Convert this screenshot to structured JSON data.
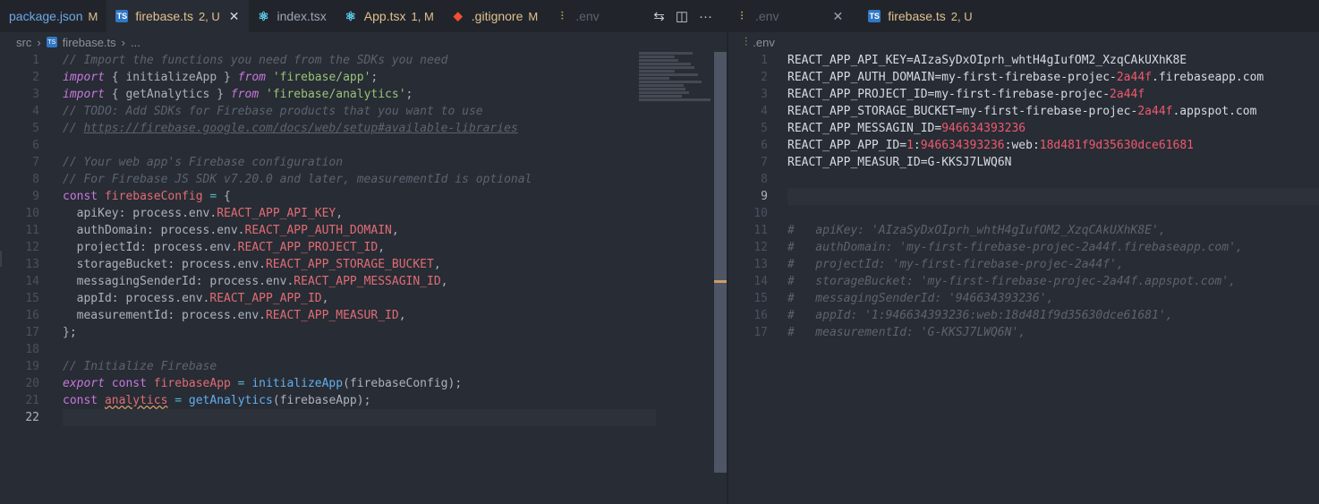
{
  "left_tabs": [
    {
      "name": "package.json",
      "status": "M",
      "icon": "npm-icon"
    },
    {
      "name": "firebase.ts",
      "status": "2, U",
      "icon": "ts-icon",
      "active": true
    },
    {
      "name": "index.tsx",
      "status": "",
      "icon": "react-icon"
    },
    {
      "name": "App.tsx",
      "status": "1, M",
      "icon": "react-icon"
    },
    {
      "name": ".gitignore",
      "status": "M",
      "icon": "git-icon"
    },
    {
      "name": ".env",
      "status": "",
      "icon": "env-icon"
    }
  ],
  "right_tabs": [
    {
      "name": ".env",
      "status": "",
      "icon": "env-icon",
      "active": true
    },
    {
      "name": "firebase.ts",
      "status": "2, U",
      "icon": "ts-icon"
    }
  ],
  "left_breadcrumb": {
    "folder": "src",
    "file": "firebase.ts",
    "more": "..."
  },
  "right_breadcrumb": {
    "file": ".env"
  },
  "icons": {
    "ts": "TS",
    "close": "✕",
    "compare": "⇆",
    "split": "◫",
    "more": "···"
  },
  "left_code": {
    "l1": "// Import the functions you need from the SDKs you need",
    "l2_kw": "import",
    "l2_a": " { initializeApp } ",
    "l2_from": "from",
    "l2_str": "'firebase/app'",
    "l2_end": ";",
    "l3_kw": "import",
    "l3_a": " { getAnalytics } ",
    "l3_from": "from",
    "l3_str": "'firebase/analytics'",
    "l3_end": ";",
    "l4": "// TODO: Add SDKs for Firebase products that you want to use",
    "l5_a": "// ",
    "l5_link": "https://firebase.google.com/docs/web/setup#available-libraries",
    "l7": "// Your web app's Firebase configuration",
    "l8": "// For Firebase JS SDK v7.20.0 and later, measurementId is optional",
    "l9_kw": "const",
    "l9_var": "firebaseConfig",
    "l9_op": " = ",
    "l9_end": "{",
    "props": [
      {
        "key": "  apiKey",
        "env": "REACT_APP_API_KEY"
      },
      {
        "key": "  authDomain",
        "env": "REACT_APP_AUTH_DOMAIN"
      },
      {
        "key": "  projectId",
        "env": "REACT_APP_PROJECT_ID"
      },
      {
        "key": "  storageBucket",
        "env": "REACT_APP_STORAGE_BUCKET"
      },
      {
        "key": "  messagingSenderId",
        "env": "REACT_APP_MESSAGIN_ID"
      },
      {
        "key": "  appId",
        "env": "REACT_APP_APP_ID"
      },
      {
        "key": "  measurementId",
        "env": "REACT_APP_MEASUR_ID"
      }
    ],
    "prop_mid": ": process.env.",
    "prop_end": ",",
    "l17": "};",
    "l19": "// Initialize Firebase",
    "l20_export": "export",
    "l20_const": "const",
    "l20_var": "firebaseApp",
    "l20_op": " = ",
    "l20_fn": "initializeApp",
    "l20_args": "(firebaseConfig);",
    "l21_const": "const",
    "l21_var": "analytics",
    "l21_op": " = ",
    "l21_fn": "getAnalytics",
    "l21_args": "(firebaseApp);",
    "line_numbers": [
      "1",
      "2",
      "3",
      "4",
      "5",
      "6",
      "7",
      "8",
      "9",
      "10",
      "11",
      "12",
      "13",
      "14",
      "15",
      "16",
      "17",
      "18",
      "19",
      "20",
      "21",
      "22"
    ]
  },
  "env_code": {
    "lines": [
      {
        "key": "REACT_APP_API_KEY=",
        "val": "AIzaSyDxOIprh_whtH4gIufOM2_XzqCAkUXhK8E"
      },
      {
        "key": "REACT_APP_AUTH_DOMAIN=",
        "val_a": "my-first-firebase-projec-",
        "val_num": "2a44f",
        "val_b": ".firebaseapp.com"
      },
      {
        "key": "REACT_APP_PROJECT_ID=",
        "val_a": "my-first-firebase-projec-",
        "val_num": "2a44f",
        "val_b": ""
      },
      {
        "key": "REACT_APP_STORAGE_BUCKET=",
        "val_a": "my-first-firebase-projec-",
        "val_num": "2a44f",
        "val_b": ".appspot.com"
      },
      {
        "key": "REACT_APP_MESSAGIN_ID=",
        "val_num": "946634393236"
      },
      {
        "key": "REACT_APP_APP_ID=",
        "val_p1": "1",
        "val_p2": ":",
        "val_p3": "946634393236",
        "val_p4": ":web:",
        "val_p5": "18d481f9d35630dce61681"
      },
      {
        "key": "REACT_APP_MEASUR_ID=",
        "val": "G-KKSJ7LWQ6N"
      }
    ],
    "comments": [
      "#   apiKey: 'AIzaSyDxOIprh_whtH4gIufOM2_XzqCAkUXhK8E',",
      "#   authDomain: 'my-first-firebase-projec-2a44f.firebaseapp.com',",
      "#   projectId: 'my-first-firebase-projec-2a44f',",
      "#   storageBucket: 'my-first-firebase-projec-2a44f.appspot.com',",
      "#   messagingSenderId: '946634393236',",
      "#   appId: '1:946634393236:web:18d481f9d35630dce61681',",
      "#   measurementId: 'G-KKSJ7LWQ6N',"
    ],
    "line_numbers": [
      "1",
      "2",
      "3",
      "4",
      "5",
      "6",
      "7",
      "8",
      "9",
      "10",
      "11",
      "12",
      "13",
      "14",
      "15",
      "16",
      "17"
    ]
  },
  "colors": {
    "accent_modified": "#e2c08d",
    "error": "#ef596f",
    "background": "#282c34"
  }
}
